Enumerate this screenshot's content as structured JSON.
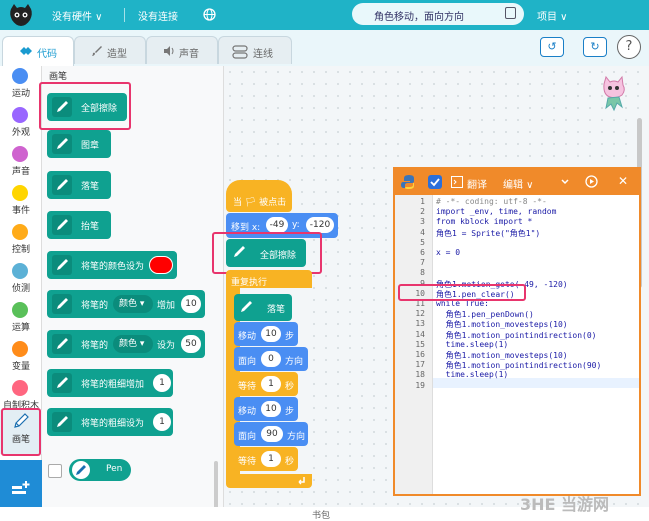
{
  "topbar": {
    "hardware": "没有硬件 ∨",
    "connection": "没有连接",
    "project_name": "角色移动，面向方向",
    "project_menu": "项目 ∨"
  },
  "tabs": [
    {
      "label": "代码"
    },
    {
      "label": "造型"
    },
    {
      "label": "声音"
    },
    {
      "label": "连线"
    }
  ],
  "categories": [
    {
      "label": "运动",
      "color": "#4a8ef3"
    },
    {
      "label": "外观",
      "color": "#9966ff"
    },
    {
      "label": "声音",
      "color": "#cf63cf"
    },
    {
      "label": "事件",
      "color": "#ffd500"
    },
    {
      "label": "控制",
      "color": "#ffab19"
    },
    {
      "label": "侦测",
      "color": "#5cb1d6"
    },
    {
      "label": "运算",
      "color": "#59c059"
    },
    {
      "label": "变量",
      "color": "#ff8c1a"
    },
    {
      "label": "自制积木",
      "color": "#ff6680"
    },
    {
      "label": "画笔",
      "color": "#0fa190"
    }
  ],
  "palette": {
    "title": "画笔",
    "blocks": [
      {
        "label": "全部擦除"
      },
      {
        "label": "图章"
      },
      {
        "label": "落笔"
      },
      {
        "label": "抬笔"
      },
      {
        "label": "将笔的颜色设为"
      },
      {
        "label_a": "将笔的",
        "dropdown": "颜色",
        "label_b": "增加",
        "value": "10"
      },
      {
        "label_a": "将笔的",
        "dropdown": "颜色",
        "label_b": "设为",
        "value": "50"
      },
      {
        "label": "将笔的粗细增加",
        "value": "1"
      },
      {
        "label": "将笔的粗细设为",
        "value": "1"
      },
      {
        "label": "Pen"
      }
    ]
  },
  "script": {
    "hat": "当 🏳 被点击",
    "move_to": {
      "label_a": "移到 x:",
      "x": "-49",
      "label_b": "y:",
      "y": "-120"
    },
    "clear": "全部擦除",
    "forever": "重复执行",
    "pen_down": "落笔",
    "move1": {
      "label_a": "移动",
      "value": "10",
      "label_b": "步"
    },
    "point1": {
      "label_a": "面向",
      "value": "0",
      "label_b": "方向"
    },
    "wait1": {
      "label_a": "等待",
      "value": "1",
      "label_b": "秒"
    },
    "move2": {
      "label_a": "移动",
      "value": "10",
      "label_b": "步"
    },
    "point2": {
      "label_a": "面向",
      "value": "90",
      "label_b": "方向"
    },
    "wait2": {
      "label_a": "等待",
      "value": "1",
      "label_b": "秒"
    }
  },
  "code_panel": {
    "translate": "翻译",
    "edit": "编辑 ∨",
    "lines": [
      {
        "n": "1",
        "text": "# -*- coding: utf-8 -*-"
      },
      {
        "n": "2",
        "text": "import _env, time, random"
      },
      {
        "n": "3",
        "text": "from kblock import *"
      },
      {
        "n": "4",
        "text": "角色1 = Sprite(\"角色1\")"
      },
      {
        "n": "5",
        "text": ""
      },
      {
        "n": "6",
        "text": "x = 0"
      },
      {
        "n": "7",
        "text": ""
      },
      {
        "n": "8",
        "text": ""
      },
      {
        "n": "9",
        "text": "角色1.motion_goto(-49, -120)"
      },
      {
        "n": "10",
        "text": "角色1.pen_clear()"
      },
      {
        "n": "11",
        "text": "while True:"
      },
      {
        "n": "12",
        "text": "  角色1.pen_penDown()"
      },
      {
        "n": "13",
        "text": "  角色1.motion_movesteps(10)"
      },
      {
        "n": "14",
        "text": "  角色1.motion_pointindirection(0)"
      },
      {
        "n": "15",
        "text": "  time.sleep(1)"
      },
      {
        "n": "16",
        "text": "  角色1.motion_movesteps(10)"
      },
      {
        "n": "17",
        "text": "  角色1.motion_pointindirection(90)"
      },
      {
        "n": "18",
        "text": "  time.sleep(1)"
      },
      {
        "n": "19",
        "text": ""
      }
    ]
  },
  "bottom": {
    "label": "书包"
  },
  "watermark": "3HE 当游网"
}
